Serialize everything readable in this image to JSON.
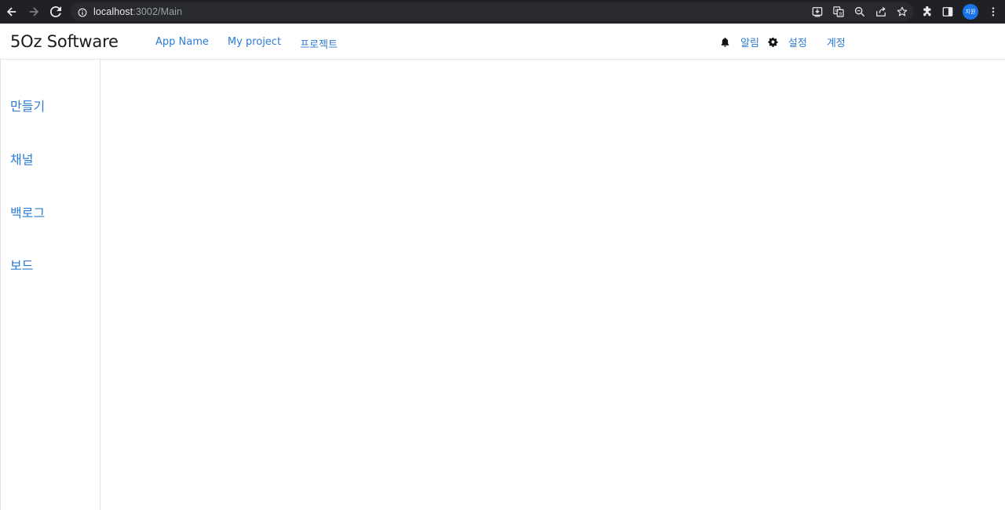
{
  "browser": {
    "url_host": "localhost",
    "url_path": ":3002/Main",
    "profile_label": "지원",
    "icons": [
      "back-icon",
      "forward-icon",
      "reload-icon",
      "info-icon",
      "install-icon",
      "translate-icon",
      "zoom-icon",
      "share-icon",
      "star-icon",
      "extensions-icon",
      "sidepanel-icon",
      "menu-icon"
    ]
  },
  "header": {
    "brand": "5Oz Software",
    "nav": [
      {
        "label": "App Name"
      },
      {
        "label": "My project"
      },
      {
        "label": "프로젝트"
      }
    ],
    "right": {
      "notifications_label": "알림",
      "settings_label": "설정",
      "account_label": "계정"
    }
  },
  "sidebar": {
    "items": [
      {
        "label": "만들기"
      },
      {
        "label": "채널"
      },
      {
        "label": "백로그"
      },
      {
        "label": "보드"
      }
    ]
  },
  "colors": {
    "link": "#2d7bd4",
    "chrome_bg": "#202124",
    "omnibox_bg": "#282a2d",
    "profile_bg": "#1a73e8"
  }
}
